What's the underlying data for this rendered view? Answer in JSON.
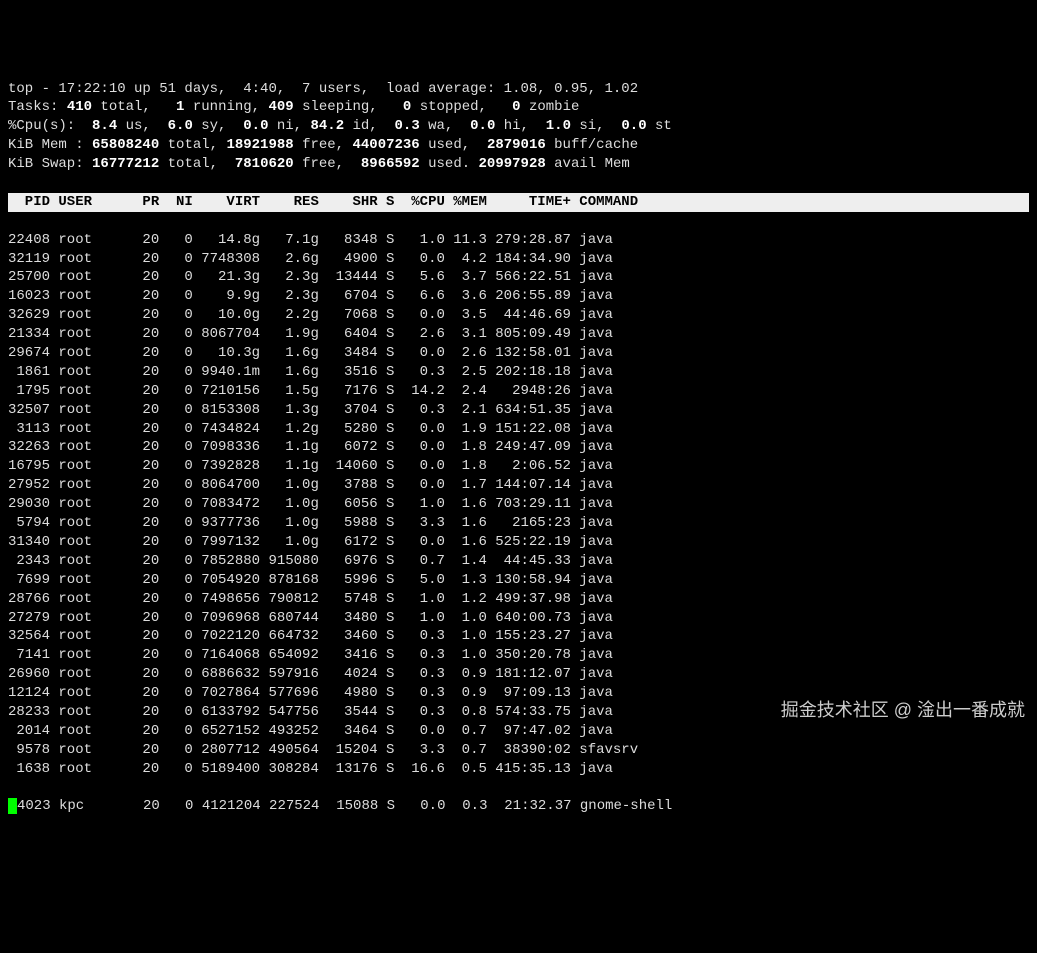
{
  "summary": {
    "l1_a": "top - 17:22:10 up 51 days,  4:40,  7 users,  load average: 1.08, 0.95, 1.02",
    "l2_a": "Tasks: ",
    "l2_b": "410 ",
    "l2_c": "total,   ",
    "l2_d": "1 ",
    "l2_e": "running, ",
    "l2_f": "409 ",
    "l2_g": "sleeping,   ",
    "l2_h": "0 ",
    "l2_i": "stopped,   ",
    "l2_j": "0 ",
    "l2_k": "zombie",
    "l3_a": "%Cpu(s):  ",
    "l3_b": "8.4 ",
    "l3_c": "us,  ",
    "l3_d": "6.0 ",
    "l3_e": "sy,  ",
    "l3_f": "0.0 ",
    "l3_g": "ni, ",
    "l3_h": "84.2 ",
    "l3_i": "id,  ",
    "l3_j": "0.3 ",
    "l3_k": "wa,  ",
    "l3_l": "0.0 ",
    "l3_m": "hi,  ",
    "l3_n": "1.0 ",
    "l3_o": "si,  ",
    "l3_p": "0.0 ",
    "l3_q": "st",
    "l4_a": "KiB Mem : ",
    "l4_b": "65808240 ",
    "l4_c": "total, ",
    "l4_d": "18921988 ",
    "l4_e": "free, ",
    "l4_f": "44007236 ",
    "l4_g": "used,  ",
    "l4_h": "2879016 ",
    "l4_i": "buff/cache",
    "l5_a": "KiB Swap: ",
    "l5_b": "16777212 ",
    "l5_c": "total,  ",
    "l5_d": "7810620 ",
    "l5_e": "free,  ",
    "l5_f": "8966592 ",
    "l5_g": "used. ",
    "l5_h": "20997928 ",
    "l5_i": "avail Mem"
  },
  "header": "  PID USER      PR  NI    VIRT    RES    SHR S  %CPU %MEM     TIME+ COMMAND                                ",
  "rows": [
    "22408 root      20   0   14.8g   7.1g   8348 S   1.0 11.3 279:28.87 java",
    "32119 root      20   0 7748308   2.6g   4900 S   0.0  4.2 184:34.90 java",
    "25700 root      20   0   21.3g   2.3g  13444 S   5.6  3.7 566:22.51 java",
    "16023 root      20   0    9.9g   2.3g   6704 S   6.6  3.6 206:55.89 java",
    "32629 root      20   0   10.0g   2.2g   7068 S   0.0  3.5  44:46.69 java",
    "21334 root      20   0 8067704   1.9g   6404 S   2.6  3.1 805:09.49 java",
    "29674 root      20   0   10.3g   1.6g   3484 S   0.0  2.6 132:58.01 java",
    " 1861 root      20   0 9940.1m   1.6g   3516 S   0.3  2.5 202:18.18 java",
    " 1795 root      20   0 7210156   1.5g   7176 S  14.2  2.4   2948:26 java",
    "32507 root      20   0 8153308   1.3g   3704 S   0.3  2.1 634:51.35 java",
    " 3113 root      20   0 7434824   1.2g   5280 S   0.0  1.9 151:22.08 java",
    "32263 root      20   0 7098336   1.1g   6072 S   0.0  1.8 249:47.09 java",
    "16795 root      20   0 7392828   1.1g  14060 S   0.0  1.8   2:06.52 java",
    "27952 root      20   0 8064700   1.0g   3788 S   0.0  1.7 144:07.14 java",
    "29030 root      20   0 7083472   1.0g   6056 S   1.0  1.6 703:29.11 java",
    " 5794 root      20   0 9377736   1.0g   5988 S   3.3  1.6   2165:23 java",
    "31340 root      20   0 7997132   1.0g   6172 S   0.0  1.6 525:22.19 java",
    " 2343 root      20   0 7852880 915080   6976 S   0.7  1.4  44:45.33 java",
    " 7699 root      20   0 7054920 878168   5996 S   5.0  1.3 130:58.94 java",
    "28766 root      20   0 7498656 790812   5748 S   1.0  1.2 499:37.98 java",
    "27279 root      20   0 7096968 680744   3480 S   1.0  1.0 640:00.73 java",
    "32564 root      20   0 7022120 664732   3460 S   0.3  1.0 155:23.27 java",
    " 7141 root      20   0 7164068 654092   3416 S   0.3  1.0 350:20.78 java",
    "26960 root      20   0 6886632 597916   4024 S   0.3  0.9 181:12.07 java",
    "12124 root      20   0 7027864 577696   4980 S   0.3  0.9  97:09.13 java",
    "28233 root      20   0 6133792 547756   3544 S   0.3  0.8 574:33.75 java",
    " 2014 root      20   0 6527152 493252   3464 S   0.0  0.7  97:47.02 java",
    " 9578 root      20   0 2807712 490564  15204 S   3.3  0.7  38390:02 sfavsrv",
    " 1638 root      20   0 5189400 308284  13176 S  16.6  0.5 415:35.13 java"
  ],
  "lastrow": "4023 kpc       20   0 4121204 227524  15088 S   0.0  0.3  21:32.37 gnome-shell",
  "watermark": "掘金技术社区 @ 淦出一番成就"
}
